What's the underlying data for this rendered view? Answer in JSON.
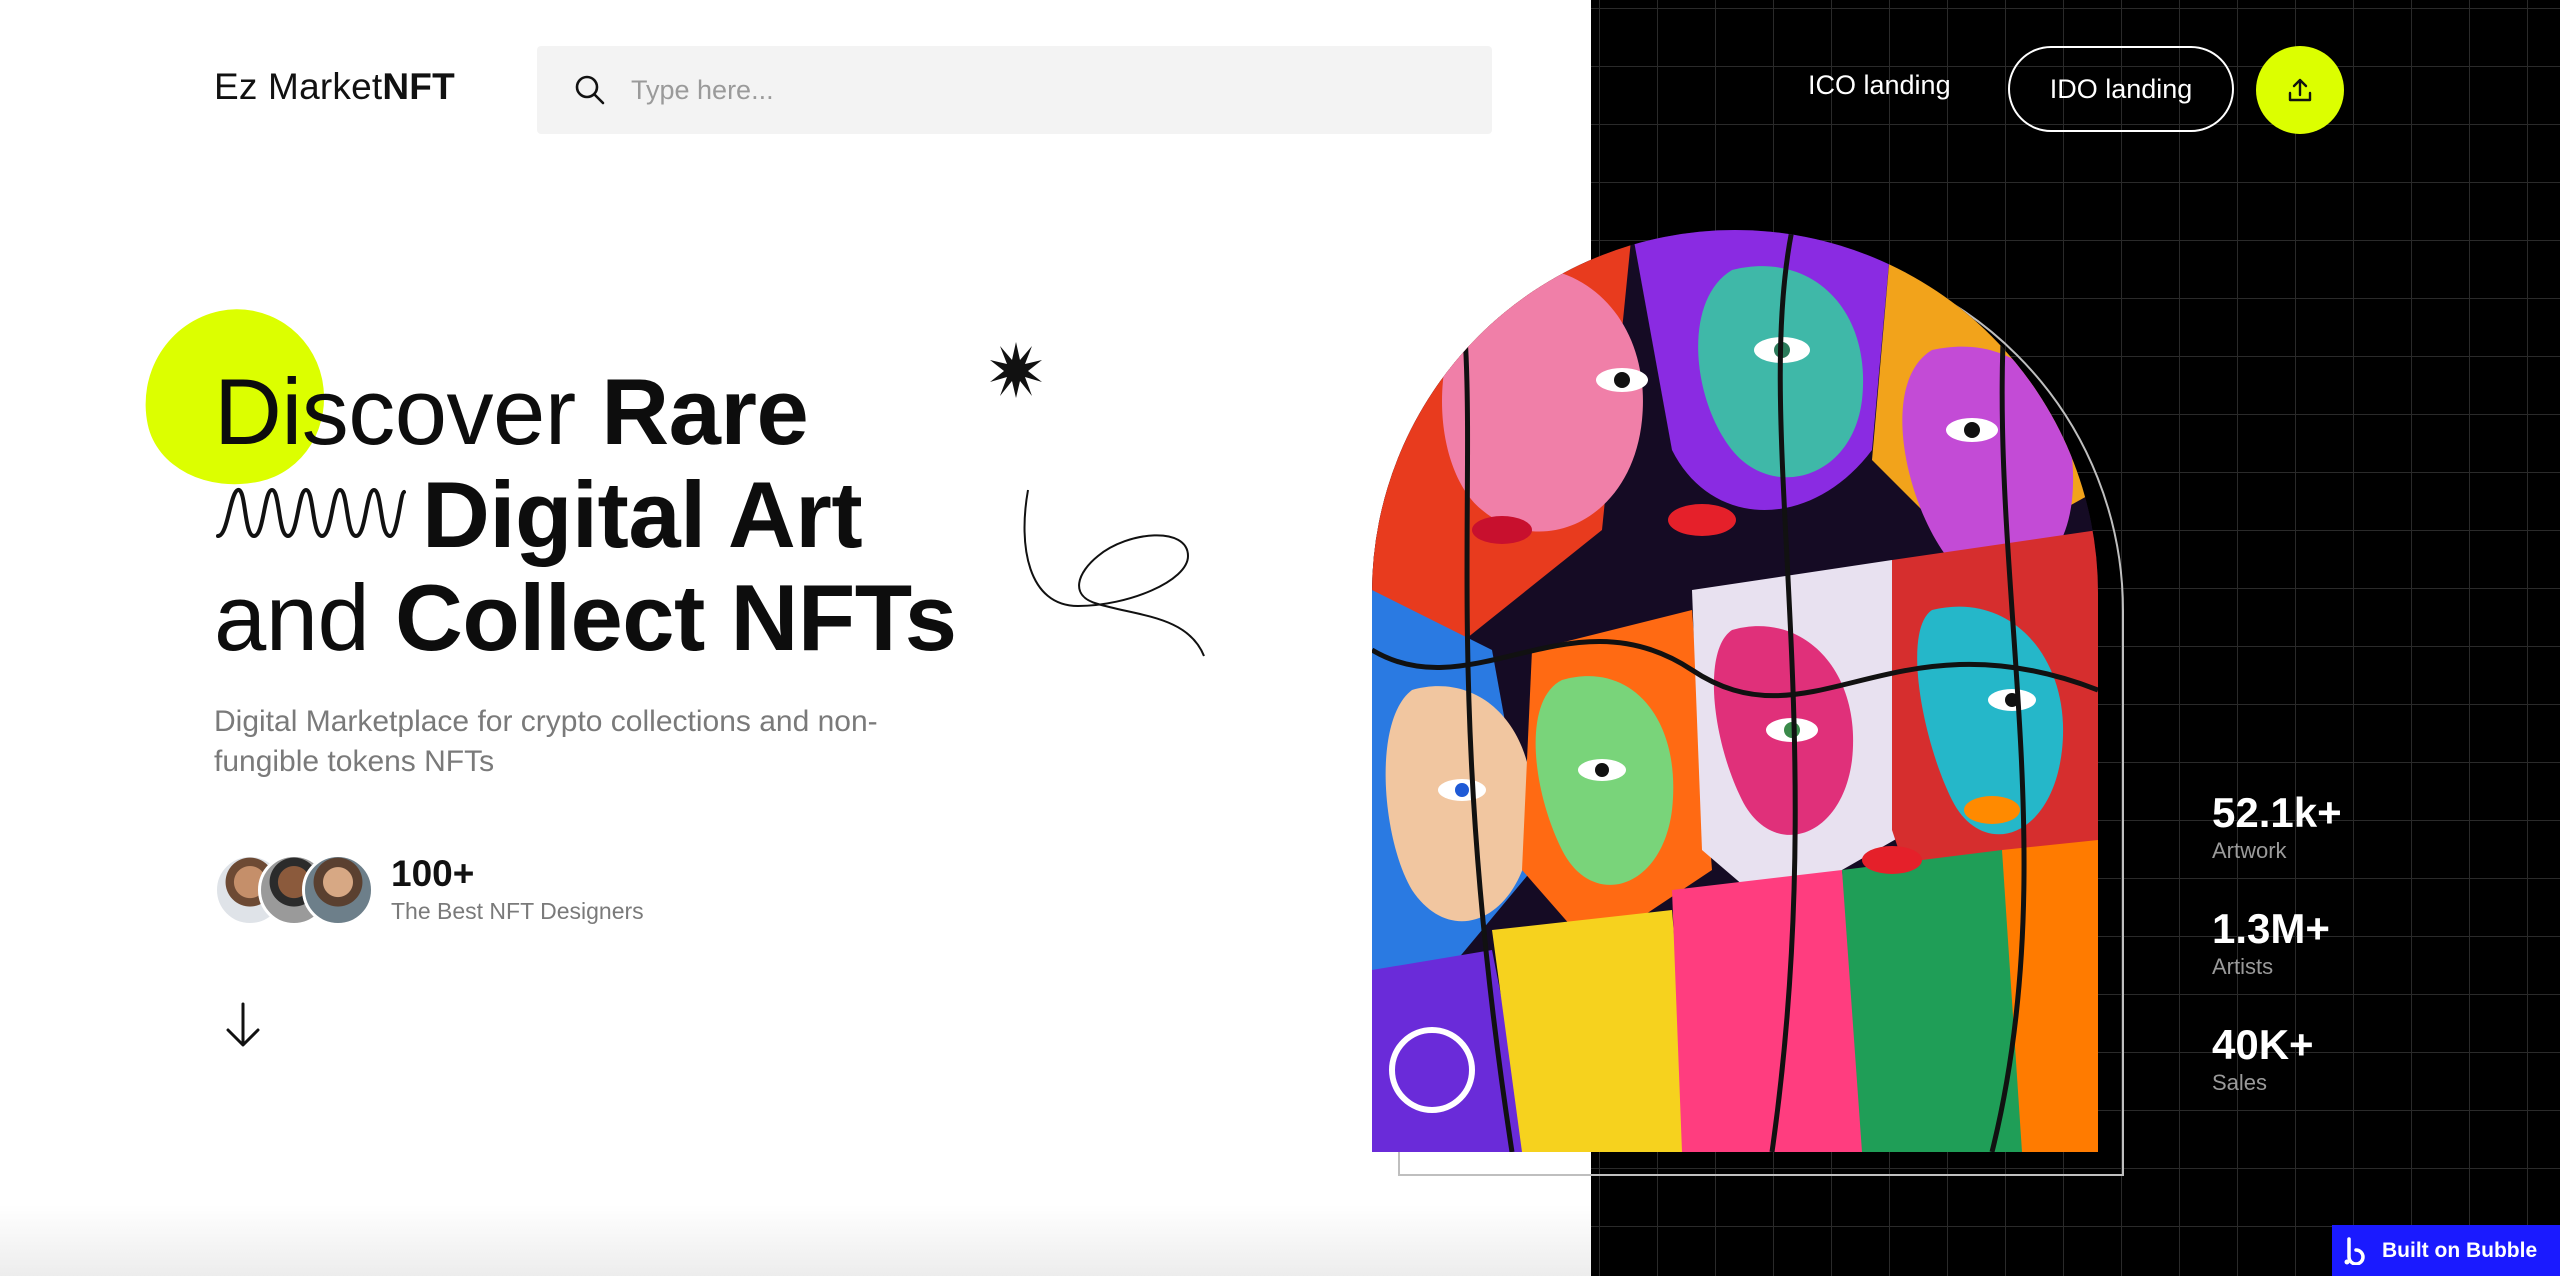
{
  "header": {
    "logo_regular": "Ez Market",
    "logo_bold": "NFT",
    "search_placeholder": "Type here...",
    "nav_ico": "ICO landing",
    "nav_ido": "IDO landing"
  },
  "hero": {
    "line1_regular": "Discover ",
    "line1_bold": "Rare",
    "line2_bold": "Digital Art",
    "line3_regular": "and ",
    "line3_bold": "Collect NFTs",
    "subtitle": "Digital Marketplace for crypto collections and non-fungible tokens NFTs",
    "designers_count": "100+",
    "designers_label": "The Best NFT Designers"
  },
  "stats": [
    {
      "value": "52.1k+",
      "label": "Artwork"
    },
    {
      "value": "1.3M+",
      "label": "Artists"
    },
    {
      "value": "40K+",
      "label": "Sales"
    }
  ],
  "badge": {
    "label": "Built on Bubble"
  },
  "colors": {
    "accent": "#dcff00",
    "dark_panel": "#000000",
    "badge": "#1a1aff"
  },
  "icons": [
    "search-icon",
    "upload-icon",
    "arrow-down-icon",
    "starburst-icon",
    "bubble-logo-icon"
  ]
}
